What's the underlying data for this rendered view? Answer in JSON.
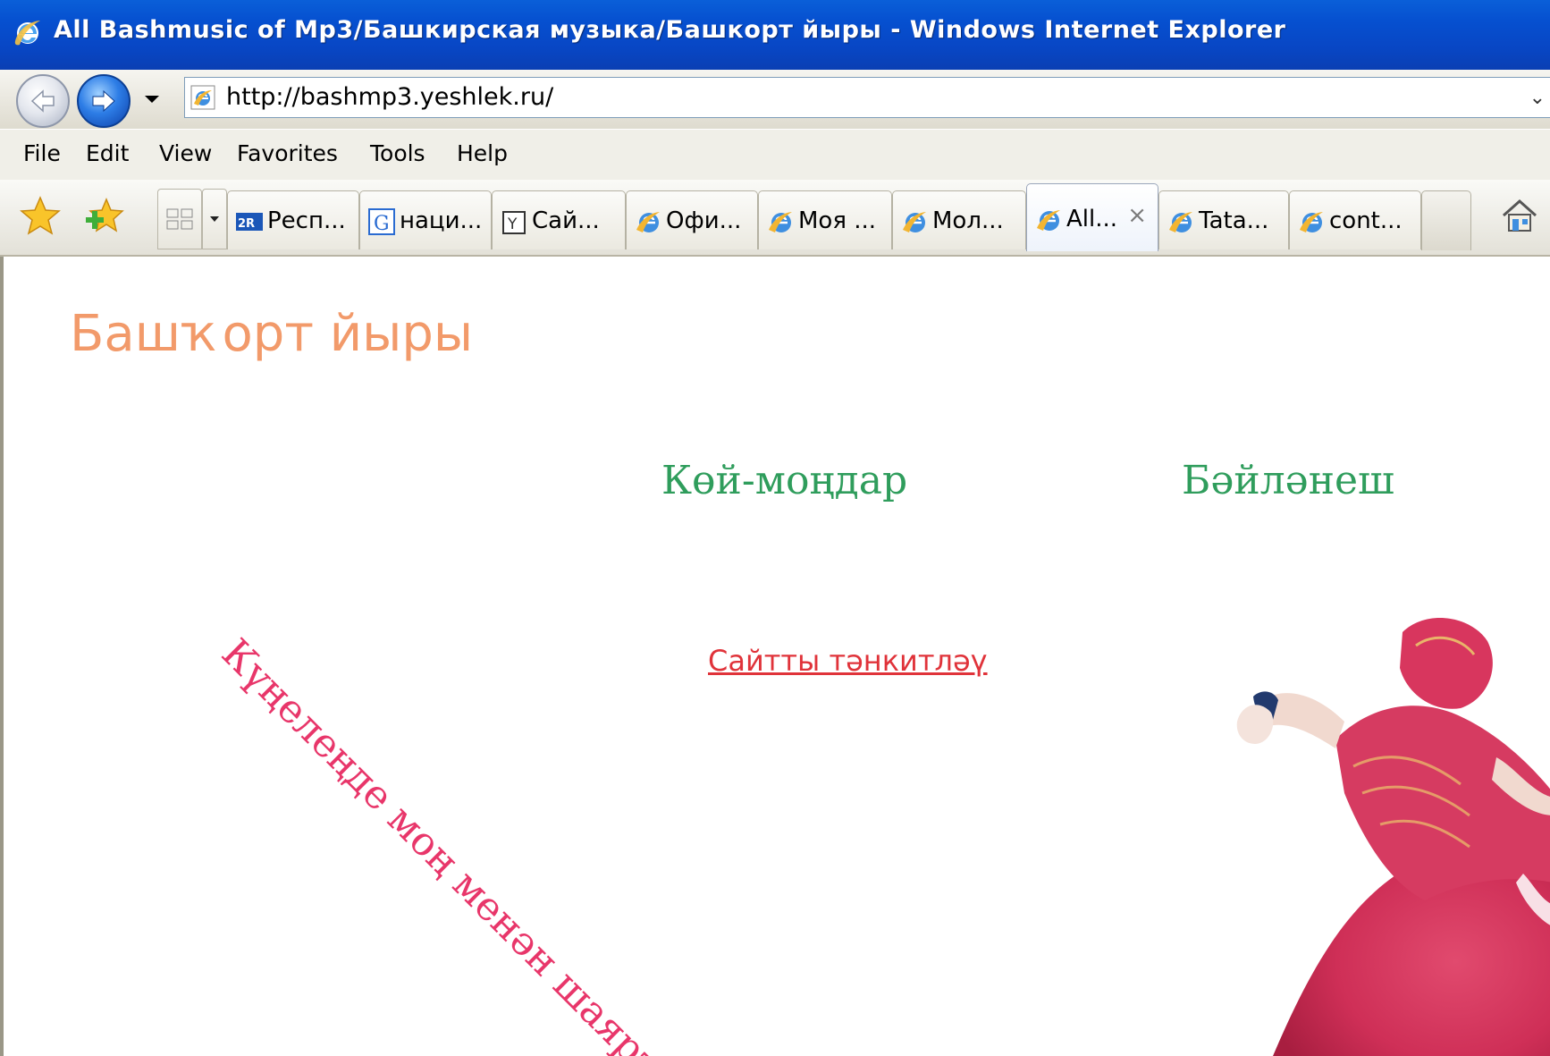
{
  "window": {
    "title": "All Bashmusic of Mp3/Башкирская музыка/Башкорт йыры - Windows Internet Explorer"
  },
  "address_bar": {
    "url": "http://bashmp3.yeshlek.ru/",
    "dropdown_glyph": "⌄"
  },
  "menu": {
    "items": [
      "File",
      "Edit",
      "View",
      "Favorites",
      "Tools",
      "Help"
    ]
  },
  "tabs": [
    {
      "label": "Респ...",
      "icon": "2gis-icon",
      "active": false
    },
    {
      "label": "наци...",
      "icon": "google-icon",
      "active": false
    },
    {
      "label": "Сай...",
      "icon": "yandex-icon",
      "active": false
    },
    {
      "label": "Офи...",
      "icon": "ie-page-icon",
      "active": false
    },
    {
      "label": "Моя ...",
      "icon": "ie-page-icon",
      "active": false
    },
    {
      "label": "Мол...",
      "icon": "ie-page-icon",
      "active": false
    },
    {
      "label": "All...",
      "icon": "ie-page-icon",
      "active": true,
      "close_glyph": "×"
    },
    {
      "label": "Tata...",
      "icon": "ie-page-icon",
      "active": false
    },
    {
      "label": "cont...",
      "icon": "ie-page-icon",
      "active": false
    }
  ],
  "page": {
    "site_title": "Башҡорт йыры",
    "nav": {
      "songs_link": "Көй-моңдар",
      "contact_link": "Бәйләнеш"
    },
    "feedback_link": "Сайтты тәнкитләү",
    "tagline": "Күңелеңде моң менән шаярт!"
  },
  "colors": {
    "title_bar": "#0650d0",
    "site_title": "#f29a6a",
    "nav_links": "#2f9d5c",
    "feedback_link": "#e0333a",
    "tagline": "#e8366a"
  }
}
